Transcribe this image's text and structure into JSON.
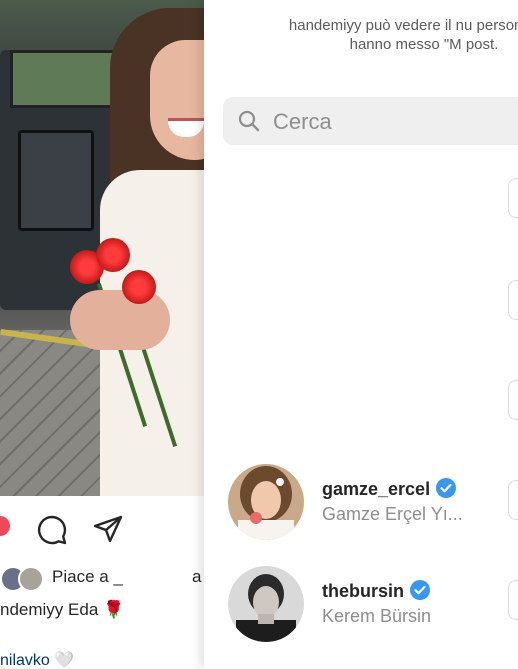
{
  "post": {
    "likes_prefix": "Piace a",
    "likes_name_visible": "_",
    "likes_tail": "a",
    "caption_user": "ndemiyy",
    "caption_text": "Eda",
    "caption_emoji": "🌹",
    "comment_user": "nilavko",
    "comment_emoji": "🤍"
  },
  "sheet": {
    "notice": "handemiyy può vedere il nu persone che hanno messo \"M post.",
    "search_placeholder": "Cerca",
    "users": [
      {
        "username": "gamze_ercel",
        "fullname": "Gamze Erçel Yı...",
        "verified": true
      },
      {
        "username": "thebursin",
        "fullname": "Kerem Bürsin",
        "verified": true
      }
    ]
  },
  "colors": {
    "verified": "#3897f0",
    "like_red": "#ed4956",
    "search_bg": "#efefef",
    "muted_text": "#8e8e8e"
  },
  "icons": [
    "search-icon",
    "heart-icon",
    "comment-icon",
    "share-icon",
    "verified-badge-icon"
  ]
}
